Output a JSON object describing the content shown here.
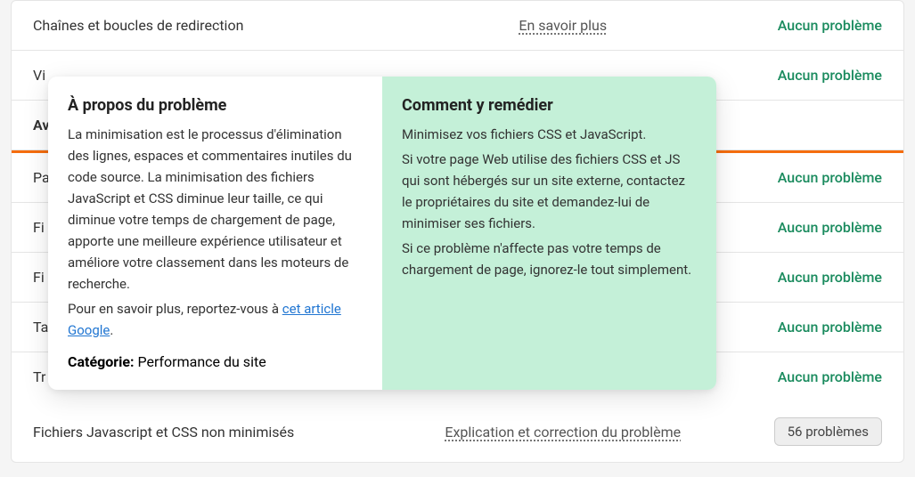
{
  "rows": [
    {
      "title": "Chaînes et boucles de redirection",
      "center": "En savoir plus",
      "status": "Aucun problème",
      "bold": false
    },
    {
      "title": "Vi",
      "center": "",
      "status": "Aucun problème",
      "bold": false
    },
    {
      "title": "Av",
      "center": "",
      "status": "",
      "bold": true
    },
    {
      "title": "Pa",
      "center": "",
      "status": "Aucun problème",
      "bold": false,
      "sectionStart": true
    },
    {
      "title": "Fi",
      "center": "",
      "status": "Aucun problème",
      "bold": false
    },
    {
      "title": "Fi",
      "center": "",
      "status": "Aucun problème",
      "bold": false
    },
    {
      "title": "Ta",
      "center": "",
      "status": "Aucun problème",
      "bold": false
    },
    {
      "title": "Tr",
      "center": "",
      "status": "Aucun problème",
      "bold": false
    }
  ],
  "lastRow": {
    "title": "Fichiers Javascript et CSS non minimisés",
    "center": "Explication et correction du problème",
    "badge": "56 problèmes"
  },
  "popover": {
    "left": {
      "heading": "À propos du problème",
      "p1": "La minimisation est le processus d'élimination des lignes, espaces et commentaires inutiles du code source. La minimisation des fichiers JavaScript et CSS diminue leur taille, ce qui diminue votre temps de chargement de page, apporte une meilleure expérience utilisateur et améliore votre classement dans les moteurs de recherche.",
      "p2_prefix": "Pour en savoir plus, reportez-vous à ",
      "p2_link": "cet article Google",
      "p2_suffix": ".",
      "category_label": "Catégorie:",
      "category_value": " Performance du site"
    },
    "right": {
      "heading": "Comment y remédier",
      "p1": "Minimisez vos fichiers CSS et JavaScript.",
      "p2": "Si votre page Web utilise des fichiers CSS et JS qui sont hébergés sur un site externe, contactez le propriétaires du site et demandez-lui de minimiser ses fichiers.",
      "p3": "Si ce problème n'affecte pas votre temps de chargement de page, ignorez-le tout simplement."
    }
  }
}
